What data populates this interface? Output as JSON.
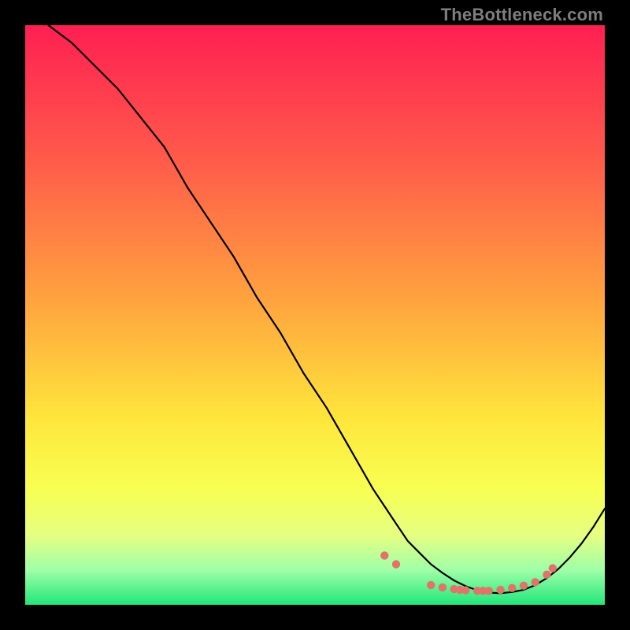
{
  "attribution": "TheBottleneck.com",
  "chart_data": {
    "type": "line",
    "title": "",
    "xlabel": "",
    "ylabel": "",
    "xlim": [
      0,
      100
    ],
    "ylim": [
      0,
      100
    ],
    "grid": false,
    "series": [
      {
        "name": "curve",
        "x": [
          4,
          8,
          12,
          16,
          20,
          24,
          28,
          32,
          36,
          40,
          44,
          48,
          52,
          56,
          60,
          62,
          64,
          66,
          68,
          70,
          72,
          74,
          76,
          78,
          80,
          82,
          84,
          86,
          88,
          90,
          92,
          94,
          96,
          98,
          100
        ],
        "values": [
          100,
          97,
          93,
          89,
          84,
          79,
          72,
          66,
          60,
          53,
          47,
          40,
          34,
          27,
          20,
          17,
          14,
          11,
          9,
          7,
          5.5,
          4.2,
          3.2,
          2.5,
          2.1,
          2.0,
          2.2,
          2.6,
          3.4,
          4.6,
          6.2,
          8.2,
          10.6,
          13.4,
          16.6
        ]
      }
    ],
    "dots": [
      {
        "x": 62,
        "y": 8.5
      },
      {
        "x": 64,
        "y": 7.0
      },
      {
        "x": 70,
        "y": 3.4
      },
      {
        "x": 72,
        "y": 3.0
      },
      {
        "x": 74,
        "y": 2.7
      },
      {
        "x": 75,
        "y": 2.6
      },
      {
        "x": 76,
        "y": 2.5
      },
      {
        "x": 78,
        "y": 2.4
      },
      {
        "x": 79,
        "y": 2.4
      },
      {
        "x": 80,
        "y": 2.4
      },
      {
        "x": 82,
        "y": 2.6
      },
      {
        "x": 84,
        "y": 2.9
      },
      {
        "x": 86,
        "y": 3.3
      },
      {
        "x": 88,
        "y": 3.9
      },
      {
        "x": 90,
        "y": 5.2
      },
      {
        "x": 91,
        "y": 6.3
      }
    ],
    "colors": {
      "gradient_top": "#ff1f52",
      "gradient_bottom": "#21e67a",
      "curve": "#000000",
      "dots": "#e2736a"
    }
  }
}
